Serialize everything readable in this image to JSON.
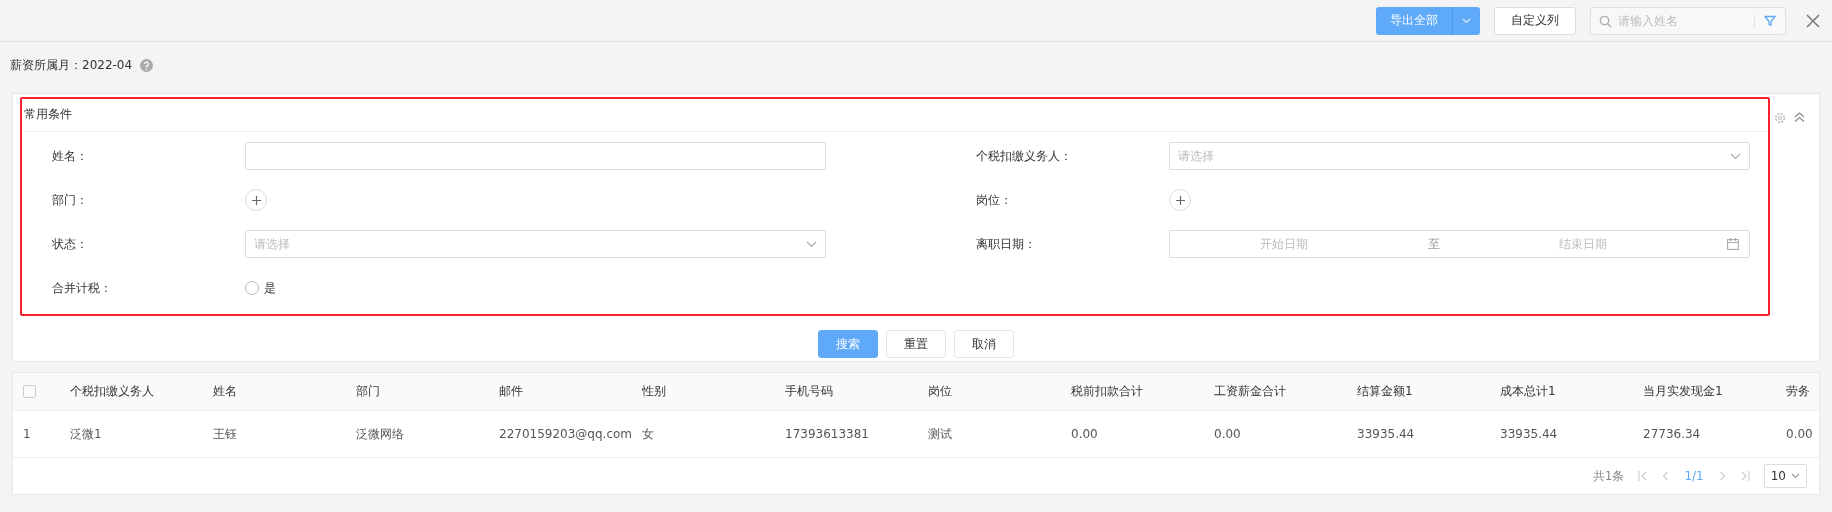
{
  "toolbar": {
    "export_button": "导出全部",
    "customize_button": "自定义列",
    "search": {
      "placeholder": "请输入姓名"
    }
  },
  "salary_month": "薪资所属月：2022-04",
  "conditions": {
    "title": "常用条件",
    "highlighted": true,
    "fields": [
      {
        "label": "姓名：",
        "kind": "text"
      },
      {
        "label": "个税扣缴义务人：",
        "kind": "select",
        "placeholder": "请选择"
      },
      {
        "label": "部门：",
        "kind": "add"
      },
      {
        "label": "岗位：",
        "kind": "add"
      },
      {
        "label": "状态：",
        "kind": "select",
        "placeholder": "请选择"
      },
      {
        "label": "离职日期：",
        "kind": "daterange",
        "start_placeholder": "开始日期",
        "separator": "至",
        "end_placeholder": "结束日期"
      },
      {
        "label": "合并计税：",
        "kind": "radio",
        "option": "是",
        "selected": false
      }
    ]
  },
  "actions": [
    {
      "label": "搜索",
      "kind": "primary"
    },
    {
      "label": "重置",
      "kind": "default"
    },
    {
      "label": "取消",
      "kind": "default"
    }
  ],
  "table": {
    "select_all_checked": false,
    "columns": [
      "个税扣缴义务人",
      "姓名",
      "部门",
      "邮件",
      "性别",
      "手机号码",
      "岗位",
      "税前扣款合计",
      "工资薪金合计",
      "结算金额1",
      "成本总计1",
      "当月实发现金1",
      "劳务"
    ],
    "rows": [
      {
        "index": "1",
        "cells": [
          "泛微1",
          "王钰",
          "泛微网络",
          "2270159203@qq.com",
          "女",
          "17393613381",
          "测试",
          "0.00",
          "0.00",
          "33935.44",
          "33935.44",
          "27736.34",
          "0.00"
        ]
      }
    ]
  },
  "pagination": {
    "total": "共1条",
    "page": "1/1",
    "page_size": "10"
  }
}
